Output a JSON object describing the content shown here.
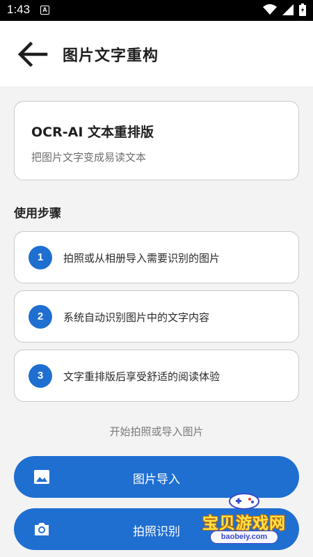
{
  "status": {
    "time": "1:43",
    "notif_letter": "A"
  },
  "header": {
    "title": "图片文字重构"
  },
  "info": {
    "title": "OCR-AI 文本重排版",
    "subtitle": "把图片文字变成易读文本"
  },
  "steps_title": "使用步骤",
  "steps": [
    {
      "num": "1",
      "text": "拍照或从相册导入需要识别的图片"
    },
    {
      "num": "2",
      "text": "系统自动识别图片中的文字内容"
    },
    {
      "num": "3",
      "text": "文字重排版后享受舒适的阅读体验"
    }
  ],
  "hint": "开始拍照或导入图片",
  "buttons": {
    "import_label": "图片导入",
    "camera_label": "拍照识别"
  },
  "watermark": {
    "text": "宝贝游戏网",
    "url": "baobeiy.com"
  },
  "colors": {
    "accent": "#1f6fd1",
    "background": "#f3f3f3"
  },
  "icons": [
    "back-arrow-icon",
    "image-icon",
    "camera-icon",
    "wifi-icon",
    "signal-icon",
    "battery-icon"
  ]
}
